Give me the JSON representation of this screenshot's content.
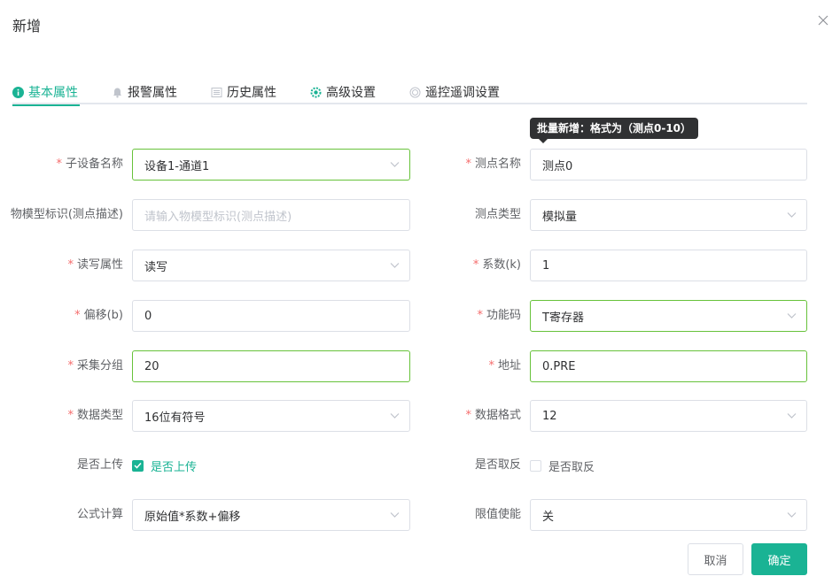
{
  "dialog": {
    "title": "新增"
  },
  "tabs": [
    {
      "label": "基本属性",
      "icon": "info-circle-icon",
      "active": true
    },
    {
      "label": "报警属性",
      "icon": "bell-icon",
      "active": false
    },
    {
      "label": "历史属性",
      "icon": "list-icon",
      "active": false
    },
    {
      "label": "高级设置",
      "icon": "gear-icon",
      "active": false
    },
    {
      "label": "遥控遥调设置",
      "icon": "target-icon",
      "active": false
    }
  ],
  "tooltip": {
    "text": "批量新增：格式为（测点0-10）"
  },
  "form": {
    "sub_device": {
      "label": "子设备名称",
      "required": "*",
      "value": "设备1-通道1"
    },
    "model_id": {
      "label": "物模型标识(测点描述)",
      "placeholder": "请输入物模型标识(测点描述)"
    },
    "rw": {
      "label": "读写属性",
      "required": "*",
      "value": "读写"
    },
    "offset": {
      "label": "偏移(b)",
      "required": "*",
      "value": "0"
    },
    "group": {
      "label": "采集分组",
      "required": "*",
      "value": "20"
    },
    "data_type": {
      "label": "数据类型",
      "required": "*",
      "value": "16位有符号"
    },
    "upload": {
      "label": "是否上传",
      "option": "是否上传",
      "checked": true
    },
    "formula": {
      "label": "公式计算",
      "value": "原始值*系数+偏移"
    },
    "point_name": {
      "label": "测点名称",
      "required": "*",
      "value": "测点0"
    },
    "point_type": {
      "label": "测点类型",
      "value": "模拟量"
    },
    "coefficient": {
      "label": "系数(k)",
      "required": "*",
      "value": "1"
    },
    "func_code": {
      "label": "功能码",
      "required": "*",
      "value": "T寄存器"
    },
    "address": {
      "label": "地址",
      "required": "*",
      "value": "0.PRE"
    },
    "data_format": {
      "label": "数据格式",
      "required": "*",
      "value": "12"
    },
    "invert": {
      "label": "是否取反",
      "option": "是否取反",
      "checked": false
    },
    "limit": {
      "label": "限值使能",
      "value": "关"
    }
  },
  "footer": {
    "cancel_label": "取消",
    "confirm_label": "确定"
  },
  "colors": {
    "accent": "#1ab394",
    "required": "#f56c6c",
    "focus_border": "#67c23a",
    "tooltip_bg": "#303133"
  }
}
